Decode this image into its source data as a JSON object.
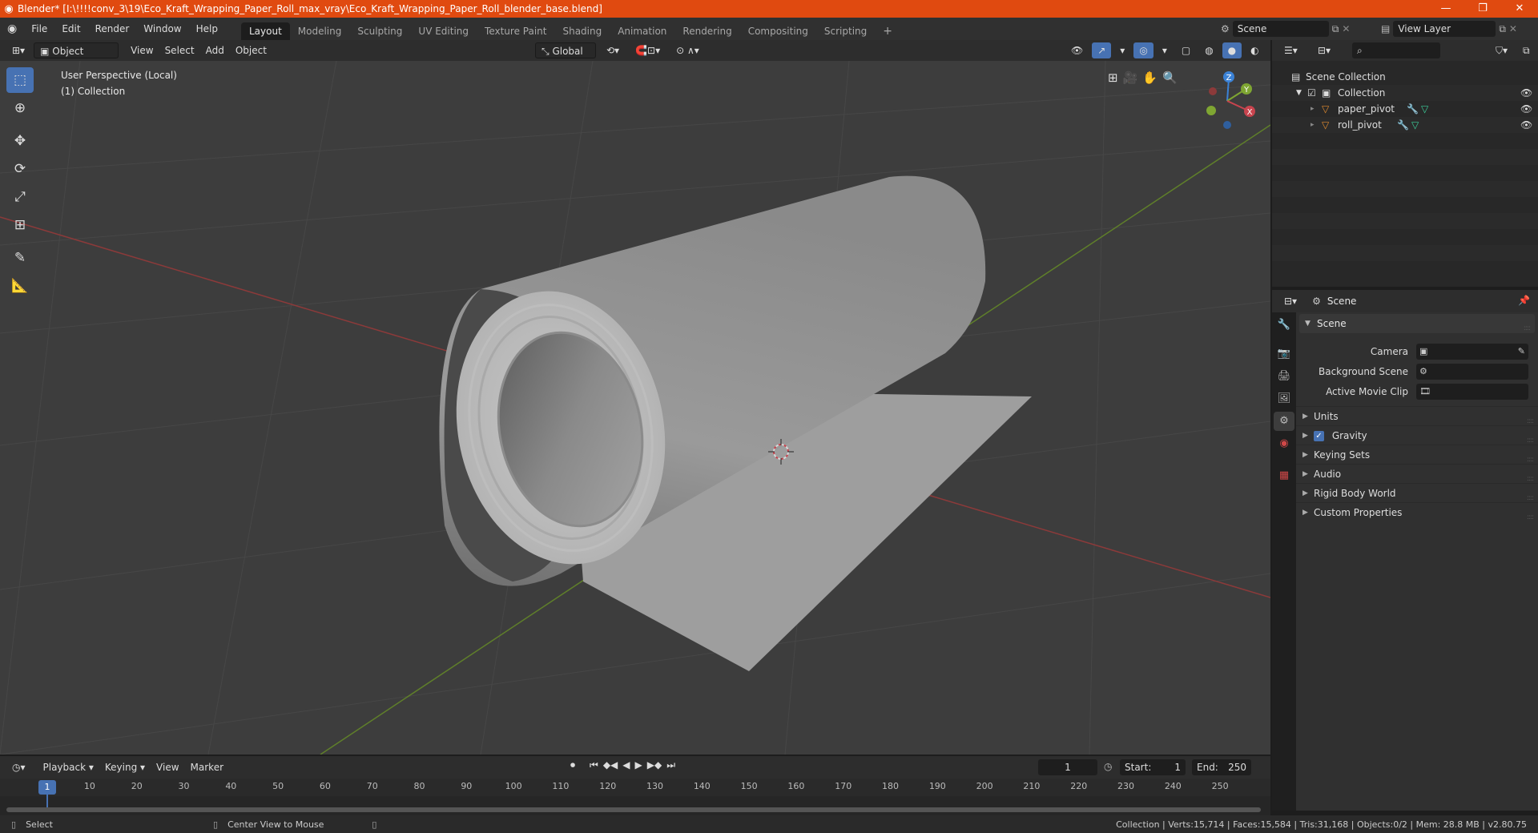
{
  "window": {
    "title": "Blender* [I:\\!!!!conv_3\\19\\Eco_Kraft_Wrapping_Paper_Roll_max_vray\\Eco_Kraft_Wrapping_Paper_Roll_blender_base.blend]",
    "controls": [
      "—",
      "❐",
      "✕"
    ]
  },
  "menu": [
    "File",
    "Edit",
    "Render",
    "Window",
    "Help"
  ],
  "workspaces": [
    "Layout",
    "Modeling",
    "Sculpting",
    "UV Editing",
    "Texture Paint",
    "Shading",
    "Animation",
    "Rendering",
    "Compositing",
    "Scripting"
  ],
  "active_workspace": "Layout",
  "add_workspace": "+",
  "scene_selector": "Scene",
  "view_layer_selector": "View Layer",
  "viewport_header": {
    "mode": "Object Mode",
    "menus": [
      "View",
      "Select",
      "Add",
      "Object"
    ],
    "orientation": "Global"
  },
  "viewport": {
    "perspective_label": "User Perspective (Local)",
    "collection_label": "(1) Collection",
    "gizmo_axes": [
      "Z",
      "Y",
      "X"
    ]
  },
  "outliner": {
    "root": "Scene Collection",
    "collection": "Collection",
    "objects": [
      "paper_pivot",
      "roll_pivot"
    ]
  },
  "properties": {
    "header_title": "Scene",
    "panel_title": "Scene",
    "rows": [
      {
        "label": "Camera"
      },
      {
        "label": "Background Scene"
      },
      {
        "label": "Active Movie Clip"
      }
    ],
    "sub_panels": [
      "Units",
      "Gravity",
      "Keying Sets",
      "Audio",
      "Rigid Body World",
      "Custom Properties"
    ],
    "gravity_checked": true
  },
  "timeline": {
    "menus": [
      "Playback",
      "Keying",
      "View",
      "Marker"
    ],
    "current_frame": "1",
    "start_label": "Start:",
    "start": "1",
    "end_label": "End:",
    "end": "250",
    "ruler": [
      "1",
      "10",
      "20",
      "30",
      "40",
      "50",
      "60",
      "70",
      "80",
      "90",
      "100",
      "110",
      "120",
      "130",
      "140",
      "150",
      "160",
      "170",
      "180",
      "190",
      "200",
      "210",
      "220",
      "230",
      "240",
      "250"
    ]
  },
  "status": {
    "select": "Select",
    "center_view": "Center View to Mouse",
    "stats": "Collection | Verts:15,714 | Faces:15,584 | Tris:31,168 | Objects:0/2 | Mem: 28.8 MB | v2.80.75"
  },
  "colors": {
    "title_bar": "#e04a10",
    "accent": "#4772b3",
    "x_axis": "#c8444e",
    "y_axis": "#7fa632",
    "z_axis": "#3b82d6"
  }
}
